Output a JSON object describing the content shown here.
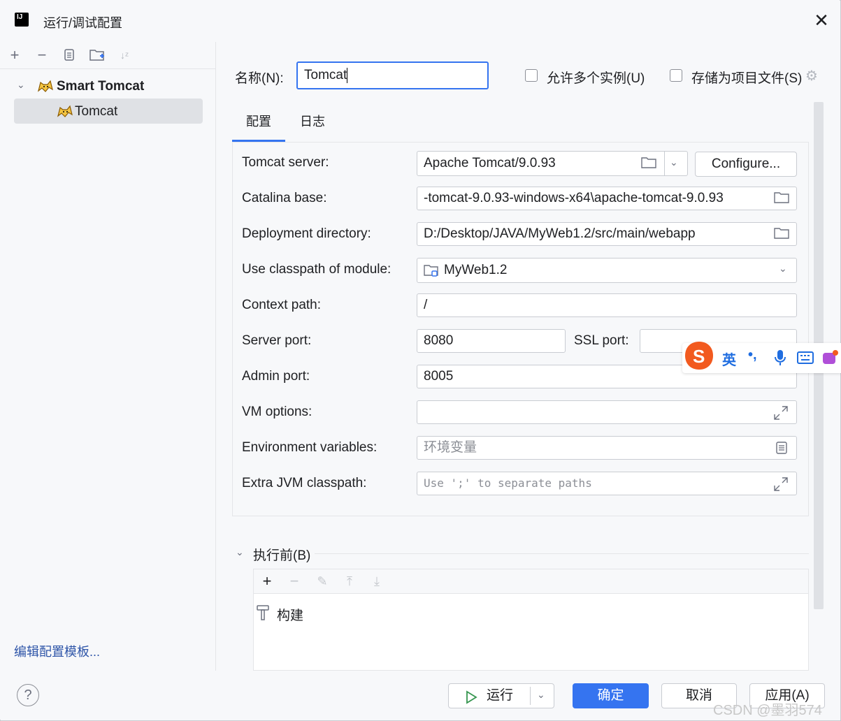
{
  "window": {
    "title": "运行/调试配置",
    "app_icon": "intellij-icon"
  },
  "left_toolbar": {
    "icons": [
      "plus-icon",
      "minus-icon",
      "copy-icon",
      "new-folder-icon",
      "sort-icon"
    ]
  },
  "tree": {
    "group_label": "Smart Tomcat",
    "item_label": "Tomcat"
  },
  "edit_templates_link": "编辑配置模板...",
  "header": {
    "name_label": "名称(N):",
    "name_value": "Tomcat",
    "allow_multiple_label": "允许多个实例(U)",
    "store_as_project_label": "存储为项目文件(S)"
  },
  "tabs": [
    {
      "label": "配置",
      "active": true
    },
    {
      "label": "日志",
      "active": false
    }
  ],
  "form": {
    "tomcat_server_label": "Tomcat server:",
    "tomcat_server_value": "Apache Tomcat/9.0.93",
    "configure_button": "Configure...",
    "catalina_base_label": "Catalina base:",
    "catalina_base_value": "-tomcat-9.0.93-windows-x64\\apache-tomcat-9.0.93",
    "deployment_dir_label": "Deployment directory:",
    "deployment_dir_value": "D:/Desktop/JAVA/MyWeb1.2/src/main/webapp",
    "classpath_module_label": "Use classpath of module:",
    "classpath_module_value": "MyWeb1.2",
    "context_path_label": "Context path:",
    "context_path_value": "/",
    "server_port_label": "Server port:",
    "server_port_value": "8080",
    "ssl_port_label": "SSL port:",
    "ssl_port_value": "",
    "admin_port_label": "Admin port:",
    "admin_port_value": "8005",
    "vm_options_label": "VM options:",
    "vm_options_value": "",
    "env_vars_label": "Environment variables:",
    "env_vars_placeholder": "环境变量",
    "extra_jvm_label": "Extra JVM classpath:",
    "extra_jvm_placeholder": "Use ';' to separate paths"
  },
  "before_launch": {
    "label": "执行前(B)",
    "item_label": "构建"
  },
  "buttons": {
    "run": "运行",
    "ok": "确定",
    "cancel": "取消",
    "apply": "应用(A)",
    "help": "?"
  },
  "ime": {
    "lang": "英",
    "punct": "•,"
  },
  "watermark": "CSDN @墨羽574",
  "colors": {
    "accent": "#3574f0",
    "link": "#2e55a8",
    "selected": "#dfe1e5"
  }
}
